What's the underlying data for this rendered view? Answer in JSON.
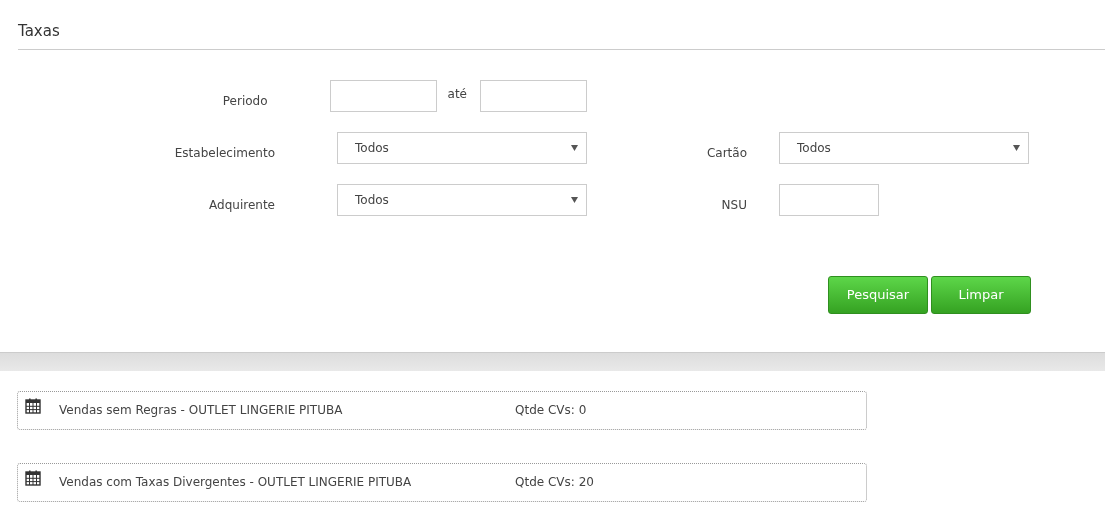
{
  "title": "Taxas",
  "filters": [
    {
      "label": "Periodo",
      "kind": "range",
      "separator": "até"
    },
    {
      "label": "Estabelecimento",
      "kind": "select",
      "value": "Todos"
    },
    {
      "label": "Cartão",
      "kind": "select",
      "value": "Todos"
    },
    {
      "label": "Adquirente",
      "kind": "select",
      "value": "Todos"
    },
    {
      "label": "NSU",
      "kind": "text"
    }
  ],
  "buttons": [
    "Pesquisar",
    "Limpar"
  ],
  "panels": [
    {
      "title": "Vendas sem Regras - OUTLET LINGERIE PITUBA",
      "count": "Qtde CVs: 0"
    },
    {
      "title": "Vendas com Taxas Divergentes - OUTLET LINGERIE PITUBA",
      "count": "Qtde CVs: 20"
    }
  ]
}
